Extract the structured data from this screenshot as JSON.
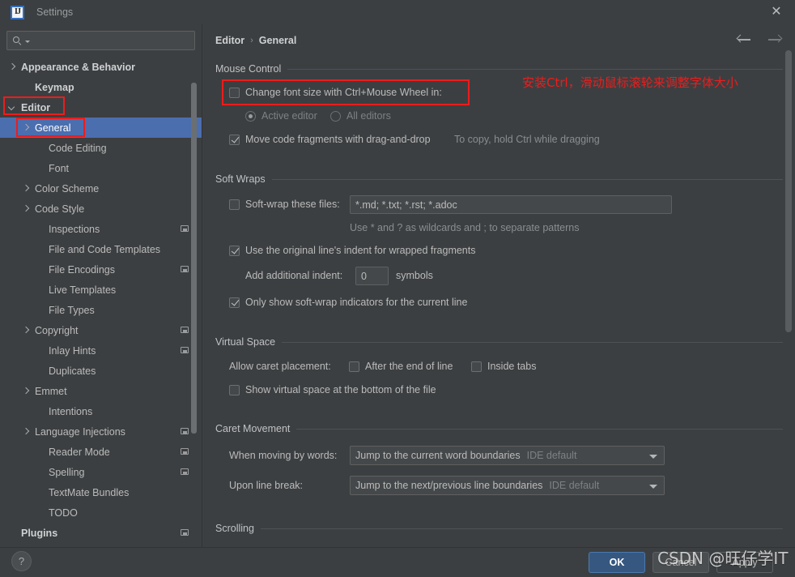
{
  "window": {
    "title": "Settings",
    "logo_text": "IJ",
    "close_icon": "✕"
  },
  "search": {
    "value": "",
    "placeholder": ""
  },
  "sidebar": {
    "items": [
      {
        "label": "Appearance & Behavior",
        "arrow": "closed",
        "bold": true,
        "indent": 10,
        "badge": false,
        "selected": false
      },
      {
        "label": "Keymap",
        "arrow": "none",
        "bold": true,
        "indent": 27,
        "badge": false,
        "selected": false
      },
      {
        "label": "Editor",
        "arrow": "open",
        "bold": true,
        "indent": 10,
        "badge": false,
        "selected": false
      },
      {
        "label": "General",
        "arrow": "closed",
        "bold": false,
        "indent": 27,
        "badge": false,
        "selected": true
      },
      {
        "label": "Code Editing",
        "arrow": "none",
        "bold": false,
        "indent": 44,
        "badge": false,
        "selected": false
      },
      {
        "label": "Font",
        "arrow": "none",
        "bold": false,
        "indent": 44,
        "badge": false,
        "selected": false
      },
      {
        "label": "Color Scheme",
        "arrow": "closed",
        "bold": false,
        "indent": 27,
        "badge": false,
        "selected": false
      },
      {
        "label": "Code Style",
        "arrow": "closed",
        "bold": false,
        "indent": 27,
        "badge": false,
        "selected": false
      },
      {
        "label": "Inspections",
        "arrow": "none",
        "bold": false,
        "indent": 44,
        "badge": true,
        "selected": false
      },
      {
        "label": "File and Code Templates",
        "arrow": "none",
        "bold": false,
        "indent": 44,
        "badge": false,
        "selected": false
      },
      {
        "label": "File Encodings",
        "arrow": "none",
        "bold": false,
        "indent": 44,
        "badge": true,
        "selected": false
      },
      {
        "label": "Live Templates",
        "arrow": "none",
        "bold": false,
        "indent": 44,
        "badge": false,
        "selected": false
      },
      {
        "label": "File Types",
        "arrow": "none",
        "bold": false,
        "indent": 44,
        "badge": false,
        "selected": false
      },
      {
        "label": "Copyright",
        "arrow": "closed",
        "bold": false,
        "indent": 27,
        "badge": true,
        "selected": false
      },
      {
        "label": "Inlay Hints",
        "arrow": "none",
        "bold": false,
        "indent": 44,
        "badge": true,
        "selected": false
      },
      {
        "label": "Duplicates",
        "arrow": "none",
        "bold": false,
        "indent": 44,
        "badge": false,
        "selected": false
      },
      {
        "label": "Emmet",
        "arrow": "closed",
        "bold": false,
        "indent": 27,
        "badge": false,
        "selected": false
      },
      {
        "label": "Intentions",
        "arrow": "none",
        "bold": false,
        "indent": 44,
        "badge": false,
        "selected": false
      },
      {
        "label": "Language Injections",
        "arrow": "closed",
        "bold": false,
        "indent": 27,
        "badge": true,
        "selected": false
      },
      {
        "label": "Reader Mode",
        "arrow": "none",
        "bold": false,
        "indent": 44,
        "badge": true,
        "selected": false
      },
      {
        "label": "Spelling",
        "arrow": "none",
        "bold": false,
        "indent": 44,
        "badge": true,
        "selected": false
      },
      {
        "label": "TextMate Bundles",
        "arrow": "none",
        "bold": false,
        "indent": 44,
        "badge": false,
        "selected": false
      },
      {
        "label": "TODO",
        "arrow": "none",
        "bold": false,
        "indent": 44,
        "badge": false,
        "selected": false
      },
      {
        "label": "Plugins",
        "arrow": "none",
        "bold": true,
        "indent": 10,
        "badge": true,
        "selected": false
      }
    ]
  },
  "main": {
    "breadcrumb": {
      "root": "Editor",
      "separator": "›",
      "leaf": "General"
    },
    "annotation": "安装Ctrl，滑动鼠标滚轮来调整字体大小",
    "groups": {
      "mouse_control": "Mouse Control",
      "soft_wraps": "Soft Wraps",
      "virtual_space": "Virtual Space",
      "caret_movement": "Caret Movement",
      "scrolling": "Scrolling"
    },
    "mouse_control": {
      "change_font_size": {
        "label": "Change font size with Ctrl+Mouse Wheel in:",
        "checked": false
      },
      "radio_active_editor": {
        "label": "Active editor",
        "selected": true
      },
      "radio_all_editors": {
        "label": "All editors",
        "selected": false
      },
      "move_code_fragments": {
        "label": "Move code fragments with drag-and-drop",
        "checked": true
      },
      "drag_hint": "To copy, hold Ctrl while dragging"
    },
    "soft_wraps": {
      "soft_wrap_files": {
        "label": "Soft-wrap these files:",
        "checked": false
      },
      "patterns_value": "*.md; *.txt; *.rst; *.adoc",
      "patterns_hint": "Use * and ? as wildcards and ; to separate patterns",
      "use_original_indent": {
        "label": "Use the original line's indent for wrapped fragments",
        "checked": true
      },
      "add_indent_label": "Add additional indent:",
      "add_indent_value": "0",
      "symbols_label": "symbols",
      "only_show_indicators": {
        "label": "Only show soft-wrap indicators for the current line",
        "checked": true
      }
    },
    "virtual_space": {
      "allow_caret_label": "Allow caret placement:",
      "after_end_of_line": {
        "label": "After the end of line",
        "checked": false
      },
      "inside_tabs": {
        "label": "Inside tabs",
        "checked": false
      },
      "show_virtual_space": {
        "label": "Show virtual space at the bottom of the file",
        "checked": false
      }
    },
    "caret_movement": {
      "when_moving_label": "When moving by words:",
      "when_moving_value": "Jump to the current word boundaries",
      "when_moving_sub": "IDE default",
      "upon_line_break_label": "Upon line break:",
      "upon_line_break_value": "Jump to the next/previous line boundaries",
      "upon_line_break_sub": "IDE default"
    }
  },
  "bottom": {
    "help_label": "?",
    "ok": "OK",
    "cancel": "Cancel",
    "apply": "Apply"
  },
  "watermark": "CSDN @旺仔学IT",
  "colors": {
    "dialog_bg": "#3c3f41",
    "selection_blue": "#4b6eaf",
    "ok_button_blue": "#365880",
    "annotation_red": "#ee1c1c",
    "text_primary": "#bbbbbb",
    "text_dim": "#7e8183"
  }
}
